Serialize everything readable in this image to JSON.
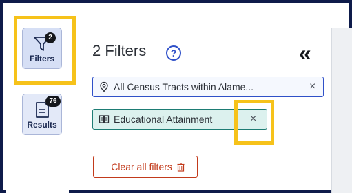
{
  "rail": {
    "filters_label": "Filters",
    "filters_count": "2",
    "results_label": "Results",
    "results_count": "76"
  },
  "panel": {
    "title": "2 Filters",
    "help_symbol": "?",
    "collapse_symbol": "«"
  },
  "chips": [
    {
      "label": "All Census Tracts within Alame...",
      "remove": "×",
      "icon": "map-pin-icon"
    },
    {
      "label": "Educational Attainment",
      "remove": "×",
      "icon": "book-icon"
    }
  ],
  "clear_button": {
    "label": "Clear all filters",
    "icon": "trash-icon"
  },
  "colors": {
    "frame": "#0e1b4a",
    "highlight": "#f6c21a",
    "accent": "#2f50c8",
    "teal": "#1d7c74",
    "danger": "#c23a1b"
  }
}
